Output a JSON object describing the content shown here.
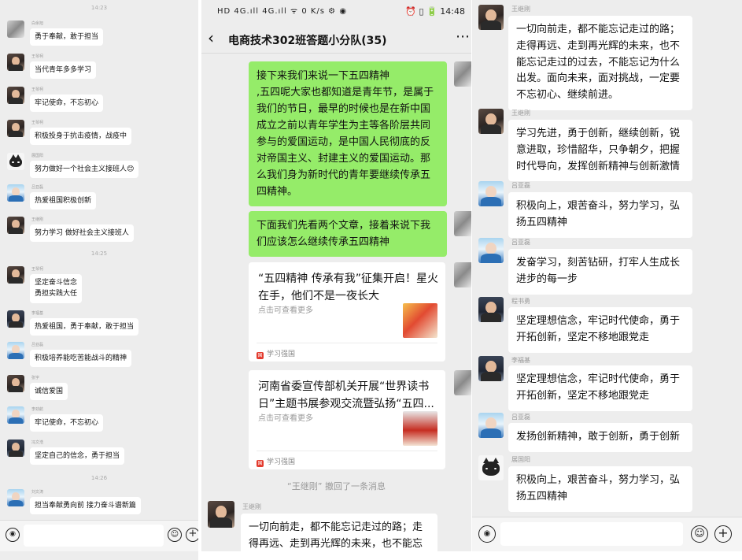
{
  "panel1": {
    "time_1": "14:23",
    "time_2": "14:25",
    "time_3": "14:26",
    "messages": [
      {
        "sender": "白余旭",
        "text": "勇于奉献，敢于担当"
      },
      {
        "sender": "王琴柯",
        "text": "当代青年多多学习"
      },
      {
        "sender": "王琴柯",
        "text": "牢记使命，不忘初心"
      },
      {
        "sender": "王琴柯",
        "text": "积极投身于抗击疫情，战疫中"
      },
      {
        "sender": "展国阳",
        "text": "努力做好一个社会主义接班人😊"
      },
      {
        "sender": "吕亚磊",
        "text": "热爱祖国积极创新"
      },
      {
        "sender": "王继刚",
        "text": "努力学习  做好社会主义接班人"
      },
      {
        "sender": "王琴柯",
        "text_line1": "坚定奋斗信念",
        "text_line2": "勇担实践大任"
      },
      {
        "sender": "李福基",
        "text": "热爱祖国，勇于奉献，敢于担当"
      },
      {
        "sender": "吕亚磊",
        "text": "积极培养能吃苦能战斗的精神"
      },
      {
        "sender": "张宇",
        "text": "诚信爱国"
      },
      {
        "sender": "李劲航",
        "text": "牢记使命，不忘初心"
      },
      {
        "sender": "冯文浩",
        "text": "坚定自己的信念，勇于担当"
      },
      {
        "sender": "刘文涛",
        "text": "担当奉献勇向前  接力奋斗谱新篇"
      }
    ],
    "voice_icon": "voice-icon",
    "emoji_icon": "emoji-icon",
    "plus_icon": "plus-icon"
  },
  "panel2": {
    "status_left": "HD 4G.ıll 4G.ıll ᯤ 0 K/s ⚙ ◉",
    "status_right": "⏰ ▯ 🔋 14:48",
    "title": "电商技术302班答题小分队(35)",
    "back_icon": "‹",
    "more_icon": "⋯",
    "green_msg_1": "接下来我们来说一下五四精神\n,五四呢大家也都知道是青年节，是属于我们的节日，最早的时候也是在新中国成立之前以青年学生为主等各阶层共同参与的爱国运动，是中国人民彻底的反对帝国主义、封建主义的爱国运动。那么我们身为新时代的青年要继续传承五四精神。",
    "green_msg_2": "下面我们先看两个文章，接着来说下我们应该怎么继续传承五四精神",
    "card1": {
      "title": "“五四精神 传承有我”征集开启！星火在手，他们不是一夜长大",
      "sub": "点击可查看更多",
      "source": "学习强国"
    },
    "card2": {
      "title": "河南省委宣传部机关开展“世界读书日”主题书展参观交流暨弘扬“五四...",
      "sub": "点击可查看更多",
      "source": "学习强国"
    },
    "recall_text": "“王继刚” 撤回了一条消息",
    "last_sender": "王继刚",
    "last_msg": "一切向前走，都不能忘记走过的路；走得再远、走到再光辉的未来，也不能忘"
  },
  "panel3": {
    "messages": [
      {
        "sender": "王继刚",
        "text": "一切向前走，都不能忘记走过的路；走得再远、走到再光辉的未来，也不能忘记走过的过去，不能忘记为什么出发。面向未来，面对挑战，一定要不忘初心、继续前进。"
      },
      {
        "sender": "王继刚",
        "text": "学习先进，勇于创新，继续创新，锐意进取，珍惜韶华，只争朝夕，把握时代导向，发挥创新精神与创新激情"
      },
      {
        "sender": "吕亚磊",
        "text": "积极向上，艰苦奋斗，努力学习，弘扬五四精神"
      },
      {
        "sender": "吕亚磊",
        "text": "发奋学习，刻苦钻研，打牢人生成长进步的每一步"
      },
      {
        "sender": "程书勇",
        "text": "坚定理想信念，牢记时代使命，勇于开拓创新，坚定不移地跟党走"
      },
      {
        "sender": "李福基",
        "text": "坚定理想信念，牢记时代使命，勇于开拓创新，坚定不移地跟党走"
      },
      {
        "sender": "吕亚磊",
        "text": "发扬创新精神，敢于创新，勇于创新"
      },
      {
        "sender": "展国阳",
        "text": "积极向上，艰苦奋斗，努力学习，弘扬五四精神"
      }
    ]
  },
  "colors": {
    "green_bubble": "#95ec69",
    "background": "#ededed",
    "bubble": "#ffffff"
  }
}
